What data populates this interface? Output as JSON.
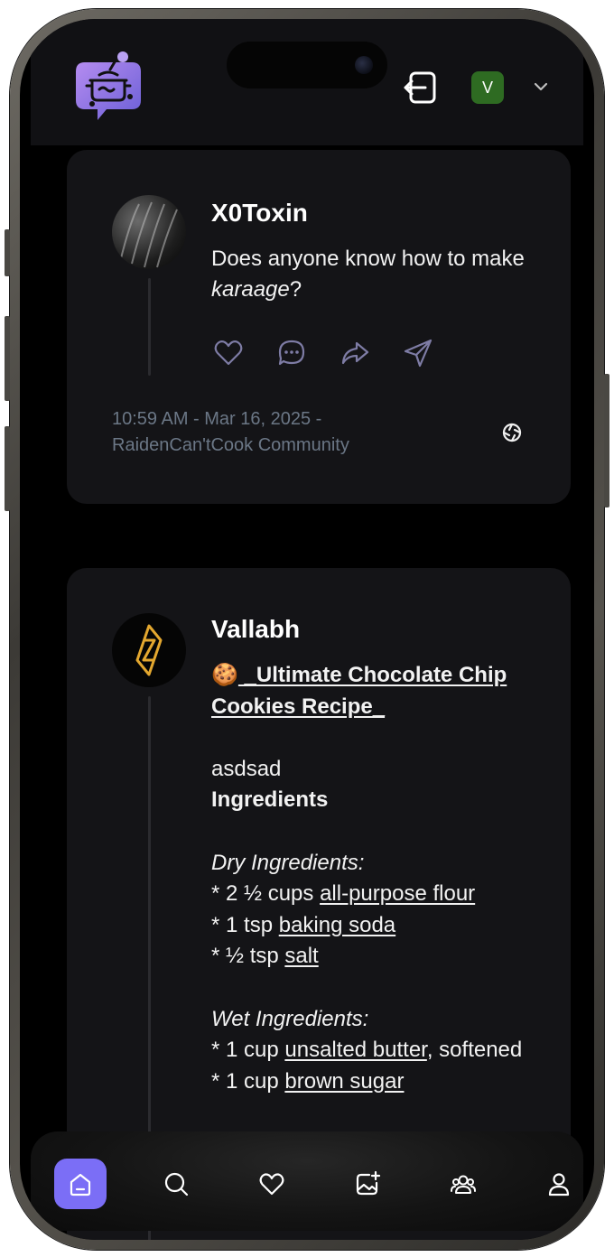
{
  "header": {
    "logo_icon": "cooking-pot-chat-logo",
    "logout_icon": "logout-icon",
    "avatar_initial": "V",
    "avatar_color": "#2e6b22",
    "menu_icon": "chevron-down-icon"
  },
  "posts": [
    {
      "username": "X0Toxin",
      "text_before": "Does anyone know how to make ",
      "text_em": "karaage",
      "text_after": "?",
      "actions": [
        "heart-icon",
        "comment-icon",
        "share-icon",
        "send-icon"
      ],
      "timestamp": "10:59 AM - Mar 16, 2025 -",
      "community": "RaidenCan'tCook Community"
    },
    {
      "username": "Vallabh",
      "emoji": "🍪",
      "title": " _Ultimate Chocolate Chip Cookies Recipe_",
      "line_asdsad": "asdsad",
      "ingredients_heading": "Ingredients",
      "dry_heading": "Dry Ingredients:",
      "dry": [
        {
          "prefix": "* 2 ½ cups ",
          "item": "all-purpose flour",
          "suffix": ""
        },
        {
          "prefix": "* 1 tsp ",
          "item": "baking soda",
          "suffix": ""
        },
        {
          "prefix": "* ½ tsp ",
          "item": "salt",
          "suffix": ""
        }
      ],
      "wet_heading": "Wet Ingredients:",
      "wet": [
        {
          "prefix": "* 1 cup ",
          "item": "unsalted butter",
          "suffix": ", softened"
        },
        {
          "prefix": "* 1 cup ",
          "item": "brown sugar",
          "suffix": ""
        }
      ]
    }
  ],
  "bottom_nav": [
    {
      "icon": "home-icon",
      "active": true
    },
    {
      "icon": "search-icon",
      "active": false
    },
    {
      "icon": "heart-icon",
      "active": false
    },
    {
      "icon": "add-image-icon",
      "active": false
    },
    {
      "icon": "community-icon",
      "active": false
    },
    {
      "icon": "profile-icon",
      "active": false
    }
  ],
  "colors": {
    "accent": "#7b6ef6",
    "card_bg": "#141417",
    "meta_text": "#6b7786"
  }
}
